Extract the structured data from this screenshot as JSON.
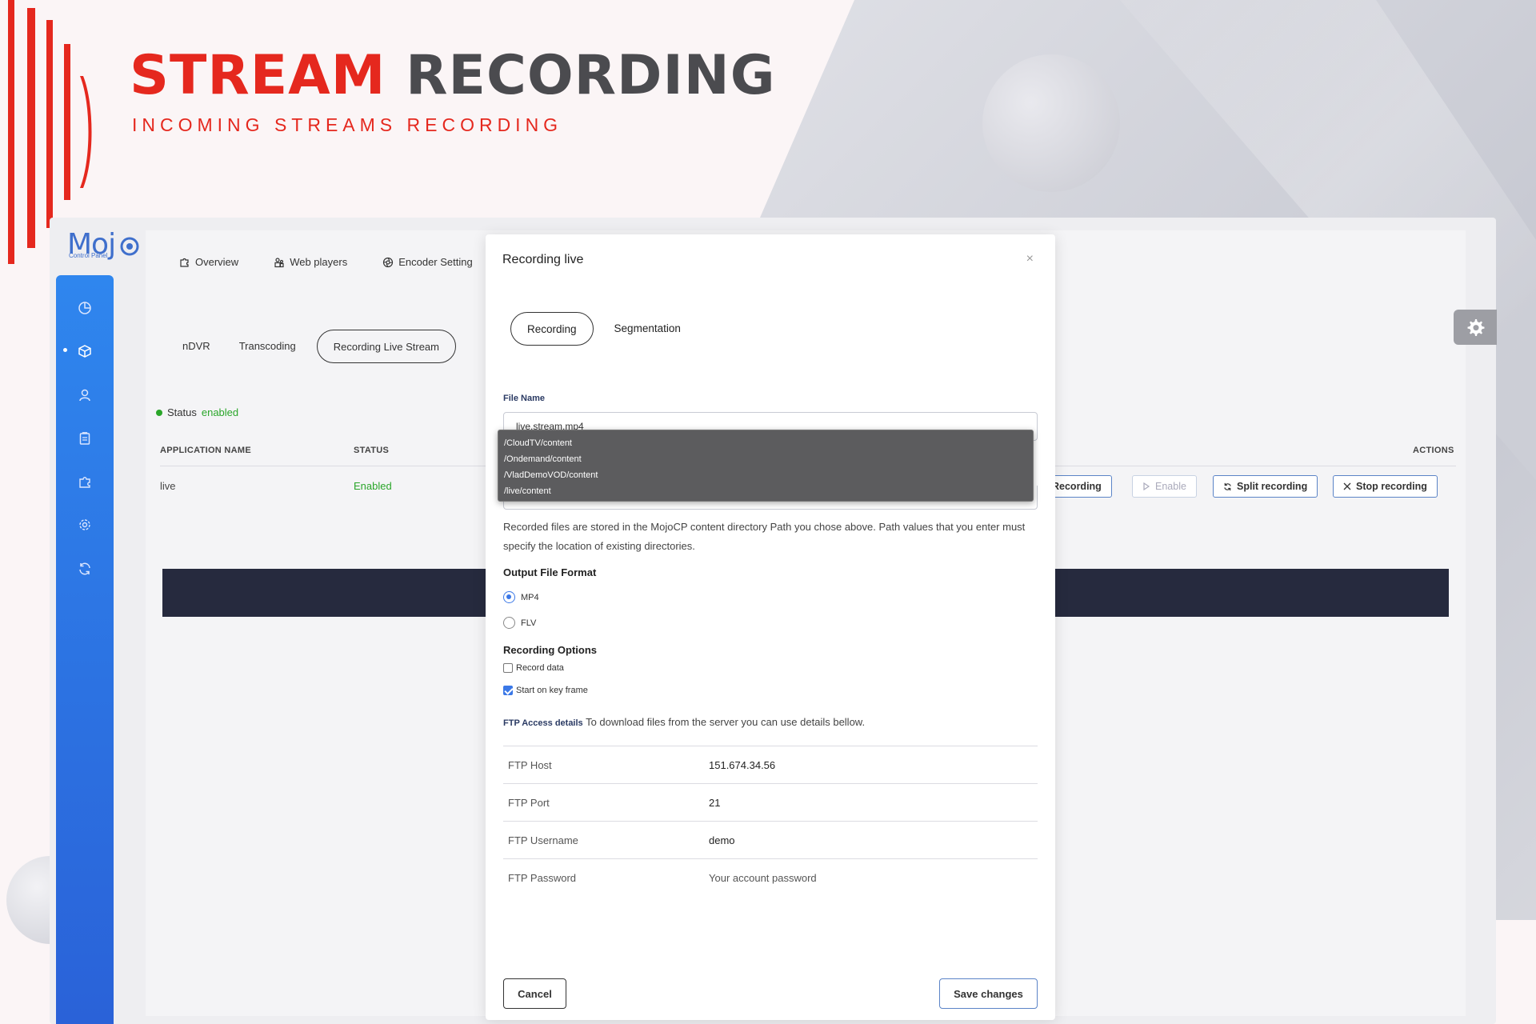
{
  "hero": {
    "title_red": "STREAM",
    "title_dark": "RECORDING",
    "subtitle": "INCOMING STREAMS RECORDING"
  },
  "logo": {
    "word": "Moj",
    "tagline": "Control Panel"
  },
  "topnav": {
    "items": [
      {
        "label": "Overview",
        "icon": "puzzle-icon"
      },
      {
        "label": "Web players",
        "icon": "people-icon"
      },
      {
        "label": "Encoder Setting",
        "icon": "aperture-icon"
      }
    ]
  },
  "subtabs": {
    "items": [
      "nDVR",
      "Transcoding",
      "Recording Live Stream"
    ],
    "active": "Recording Live Stream"
  },
  "status": {
    "label": "Status",
    "value": "enabled"
  },
  "table": {
    "headers": {
      "app_name": "APPLICATION NAME",
      "status": "STATUS",
      "actions": "ACTIONS"
    },
    "rows": [
      {
        "app_name": "live",
        "status": "Enabled"
      }
    ]
  },
  "actions": {
    "recording": "Recording",
    "enable": "Enable",
    "split": "Split recording",
    "stop": "Stop recording"
  },
  "modal": {
    "title": "Recording live",
    "close": "×",
    "tabs": [
      "Recording",
      "Segmentation"
    ],
    "file_name_label": "File Name",
    "file_name_value": "live.stream.mp4",
    "dropdown_options": [
      "/CloudTV/content",
      "/Ondemand/content",
      "/VladDemoVOD/content",
      "/live/content"
    ],
    "help_text": "Recorded files are stored in the MojoCP content directory Path you chose above. Path values that you enter must specify the location of existing directories.",
    "output_format_title": "Output File Format",
    "formats": [
      {
        "label": "MP4",
        "selected": true
      },
      {
        "label": "FLV",
        "selected": false
      }
    ],
    "options_title": "Recording Options",
    "options": [
      {
        "label": "Record data",
        "checked": false
      },
      {
        "label": "Start on key frame",
        "checked": true
      }
    ],
    "ftp_label": "FTP Access details",
    "ftp_note": "To download files from the server you can use details bellow.",
    "ftp": [
      {
        "key": "FTP Host",
        "value": "151.674.34.56"
      },
      {
        "key": "FTP Port",
        "value": "21"
      },
      {
        "key": "FTP Username",
        "value": "demo"
      },
      {
        "key": "FTP Password",
        "value": "Your account password"
      }
    ],
    "cancel": "Cancel",
    "save": "Save changes"
  },
  "colors": {
    "brand_red": "#e5281e",
    "sidebar_blue": "#2a62d8",
    "accent_blue": "#3b78e7",
    "status_green": "#2aa62a"
  }
}
